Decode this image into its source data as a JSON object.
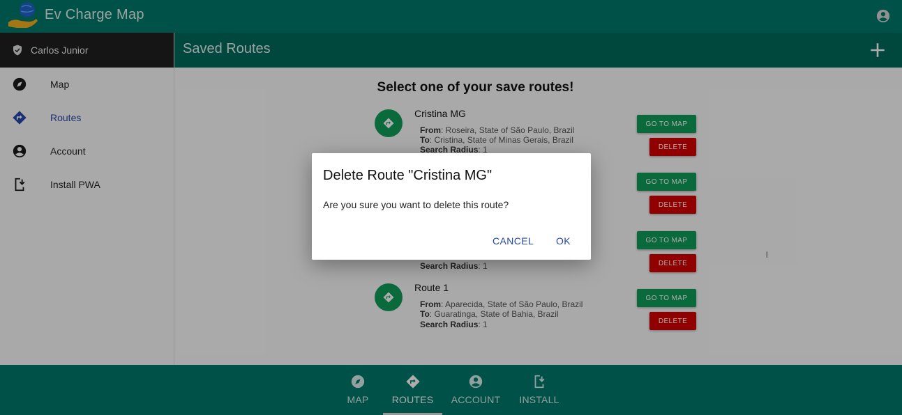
{
  "app": {
    "title": "Ev Charge Map",
    "logo_icon": "globe-hand-icon",
    "account_icon": "account-circle-icon"
  },
  "sidebar": {
    "user_name": "Carlos Junior",
    "user_icon": "shield-check-icon",
    "items": [
      {
        "label": "Map",
        "icon": "compass-icon",
        "active": false
      },
      {
        "label": "Routes",
        "icon": "directions-icon",
        "active": true
      },
      {
        "label": "Account",
        "icon": "account-circle-icon",
        "active": false
      },
      {
        "label": "Install PWA",
        "icon": "install-mobile-icon",
        "active": false
      }
    ]
  },
  "header": {
    "title": "Saved Routes",
    "add_icon": "plus-icon"
  },
  "main": {
    "heading": "Select one of your save routes!",
    "labels": {
      "from": "From",
      "to": "To",
      "radius": "Search Radius"
    },
    "routes": [
      {
        "name": "Cristina MG",
        "from": "Roseira, State of São Paulo, Brazil",
        "to": "Cristina, State of Minas Gerais, Brazil",
        "radius": "1"
      },
      {
        "name": "",
        "from": "",
        "to": "",
        "radius": ""
      },
      {
        "name": "",
        "from": "",
        "to": "l",
        "radius": "1"
      },
      {
        "name": "Route 1",
        "from": "Aparecida, State of São Paulo, Brazil",
        "to": "Guaratinga, State of Bahia, Brazil",
        "radius": "1"
      }
    ],
    "go_label": "GO TO MAP",
    "delete_label": "DELETE"
  },
  "bottom_nav": [
    {
      "label": "MAP",
      "icon": "compass-icon",
      "active": false
    },
    {
      "label": "ROUTES",
      "icon": "directions-icon",
      "active": true
    },
    {
      "label": "ACCOUNT",
      "icon": "account-circle-icon",
      "active": false
    },
    {
      "label": "INSTALL",
      "icon": "install-mobile-icon",
      "active": false
    }
  ],
  "dialog": {
    "title": "Delete Route \"Cristina MG\"",
    "message": "Are you sure you want to delete this route?",
    "cancel_label": "CANCEL",
    "ok_label": "OK"
  },
  "colors": {
    "primary": "#007a6b",
    "primary_dark": "#00695c",
    "go_green": "#0f9d58",
    "delete_red": "#d50000",
    "accent_blue": "#2648a8"
  }
}
